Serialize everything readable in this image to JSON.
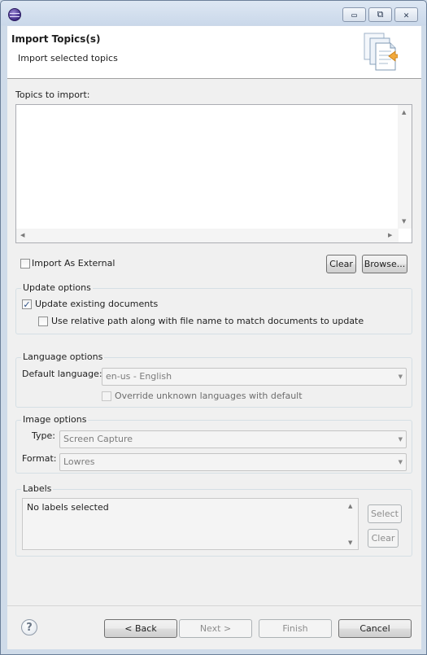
{
  "window": {
    "controls": {
      "minimize_glyph": "▭",
      "restore_glyph": "⧉",
      "close_glyph": "✕"
    }
  },
  "banner": {
    "title": "Import Topics(s)",
    "description": "Import selected topics"
  },
  "topics": {
    "label": "Topics to import:",
    "items": []
  },
  "import_external": {
    "label": "Import As External",
    "checked": false
  },
  "buttons": {
    "clear": "Clear",
    "browse": "Browse..."
  },
  "update_options": {
    "title": "Update options",
    "update_existing": {
      "label": "Update existing documents",
      "checked": true
    },
    "relative_path": {
      "label": "Use relative path along with file name to match documents to update",
      "checked": false
    }
  },
  "language_options": {
    "title": "Language options",
    "default_language_label": "Default language:",
    "default_language_value": "en-us - English",
    "override": {
      "label": "Override unknown languages with default",
      "checked": false
    }
  },
  "image_options": {
    "title": "Image options",
    "type_label": "Type:",
    "type_value": "Screen Capture",
    "format_label": "Format:",
    "format_value": "Lowres"
  },
  "labels": {
    "title": "Labels",
    "content": "No labels selected",
    "select_button": "Select",
    "clear_button": "Clear"
  },
  "footer": {
    "help_glyph": "?",
    "back": "< Back",
    "next": "Next >",
    "finish": "Finish",
    "cancel": "Cancel"
  },
  "colors": {
    "window_frame": "#cfdbe9",
    "dialog_background": "#f0f0f0",
    "group_border": "#d5dfe5"
  }
}
